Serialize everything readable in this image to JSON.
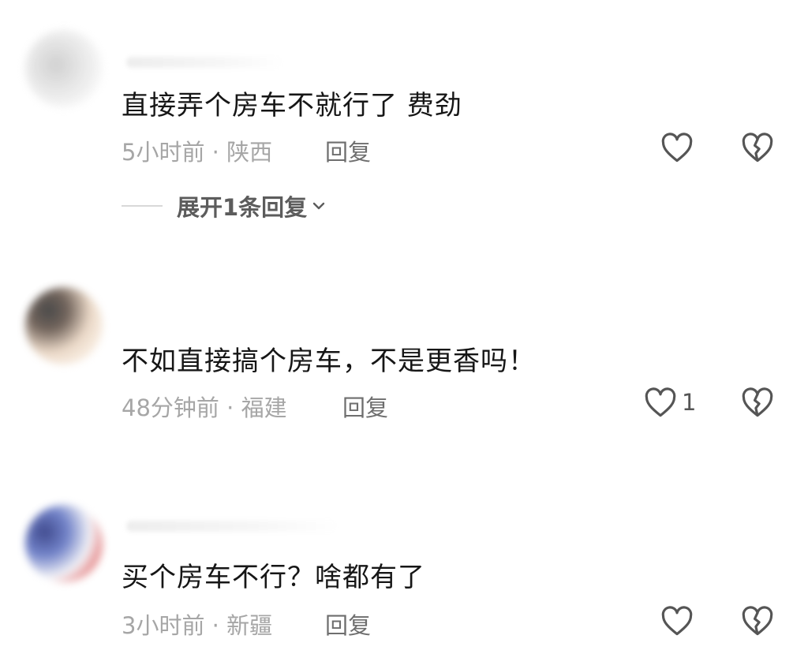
{
  "comments": [
    {
      "text": "直接弄个房车不就行了   费劲",
      "time": "5小时前",
      "location": "陕西",
      "reply_label": "回复",
      "like_count": "",
      "expand_label": "展开1条回复"
    },
    {
      "text": "不如直接搞个房车，不是更香吗！",
      "time": "48分钟前",
      "location": "福建",
      "reply_label": "回复",
      "like_count": "1"
    },
    {
      "text": "买个房车不行？啥都有了",
      "time": "3小时前",
      "location": "新疆",
      "reply_label": "回复",
      "like_count": ""
    }
  ],
  "icons": {
    "like": "heart-outline-icon",
    "dislike": "broken-heart-icon",
    "expand": "chevron-down-icon"
  },
  "colors": {
    "text": "#161616",
    "meta": "#a6a6a6",
    "reply": "#6e6e6e",
    "icon": "#555555"
  }
}
